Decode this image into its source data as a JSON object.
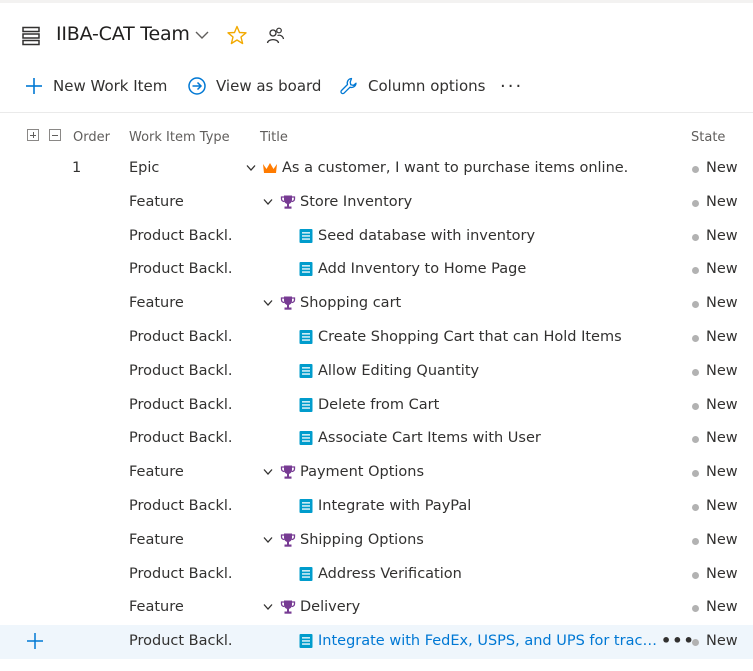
{
  "header": {
    "team_name": "IIBA-CAT Team"
  },
  "toolbar": {
    "new_work_item": "New Work Item",
    "view_as_board": "View as board",
    "column_options": "Column options",
    "more": "···"
  },
  "columns": {
    "order": "Order",
    "type": "Work Item Type",
    "title": "Title",
    "state": "State"
  },
  "rows": [
    {
      "order": "1",
      "type": "Epic",
      "level": 0,
      "icon": "crown-icon",
      "chevron": true,
      "title": "As a customer, I want to purchase items online.",
      "state": "New"
    },
    {
      "order": "",
      "type": "Feature",
      "level": 1,
      "icon": "trophy-icon",
      "chevron": true,
      "title": "Store Inventory",
      "state": "New"
    },
    {
      "order": "",
      "type": "Product Backl...",
      "level": 2,
      "icon": "backlog-item-icon",
      "chevron": false,
      "title": "Seed database with inventory",
      "state": "New"
    },
    {
      "order": "",
      "type": "Product Backl...",
      "level": 2,
      "icon": "backlog-item-icon",
      "chevron": false,
      "title": "Add Inventory to Home Page",
      "state": "New"
    },
    {
      "order": "",
      "type": "Feature",
      "level": 1,
      "icon": "trophy-icon",
      "chevron": true,
      "title": "Shopping cart",
      "state": "New"
    },
    {
      "order": "",
      "type": "Product Backl...",
      "level": 2,
      "icon": "backlog-item-icon",
      "chevron": false,
      "title": "Create Shopping Cart that can Hold Items",
      "state": "New"
    },
    {
      "order": "",
      "type": "Product Backl...",
      "level": 2,
      "icon": "backlog-item-icon",
      "chevron": false,
      "title": "Allow Editing Quantity",
      "state": "New"
    },
    {
      "order": "",
      "type": "Product Backl...",
      "level": 2,
      "icon": "backlog-item-icon",
      "chevron": false,
      "title": "Delete from Cart",
      "state": "New"
    },
    {
      "order": "",
      "type": "Product Backl...",
      "level": 2,
      "icon": "backlog-item-icon",
      "chevron": false,
      "title": "Associate Cart Items with User",
      "state": "New"
    },
    {
      "order": "",
      "type": "Feature",
      "level": 1,
      "icon": "trophy-icon",
      "chevron": true,
      "title": "Payment Options",
      "state": "New"
    },
    {
      "order": "",
      "type": "Product Backl...",
      "level": 2,
      "icon": "backlog-item-icon",
      "chevron": false,
      "title": "Integrate with PayPal",
      "state": "New"
    },
    {
      "order": "",
      "type": "Feature",
      "level": 1,
      "icon": "trophy-icon",
      "chevron": true,
      "title": "Shipping Options",
      "state": "New"
    },
    {
      "order": "",
      "type": "Product Backl...",
      "level": 2,
      "icon": "backlog-item-icon",
      "chevron": false,
      "title": "Address Verification",
      "state": "New"
    },
    {
      "order": "",
      "type": "Feature",
      "level": 1,
      "icon": "trophy-icon",
      "chevron": true,
      "title": "Delivery",
      "state": "New"
    },
    {
      "order": "",
      "type": "Product Backl...",
      "level": 2,
      "icon": "backlog-item-icon",
      "chevron": false,
      "title": "Integrate with FedEx, USPS, and UPS for tracking h...",
      "state": "New",
      "selected": true,
      "row_more": "•••"
    }
  ],
  "colors": {
    "accent": "#0078d4",
    "epic": "#ff7b00",
    "feature": "#773b93",
    "backlog_item": "#009ccc",
    "state_new": "#b2b2b2",
    "star": "#f2a900",
    "selected_row": "#eff6fc"
  }
}
